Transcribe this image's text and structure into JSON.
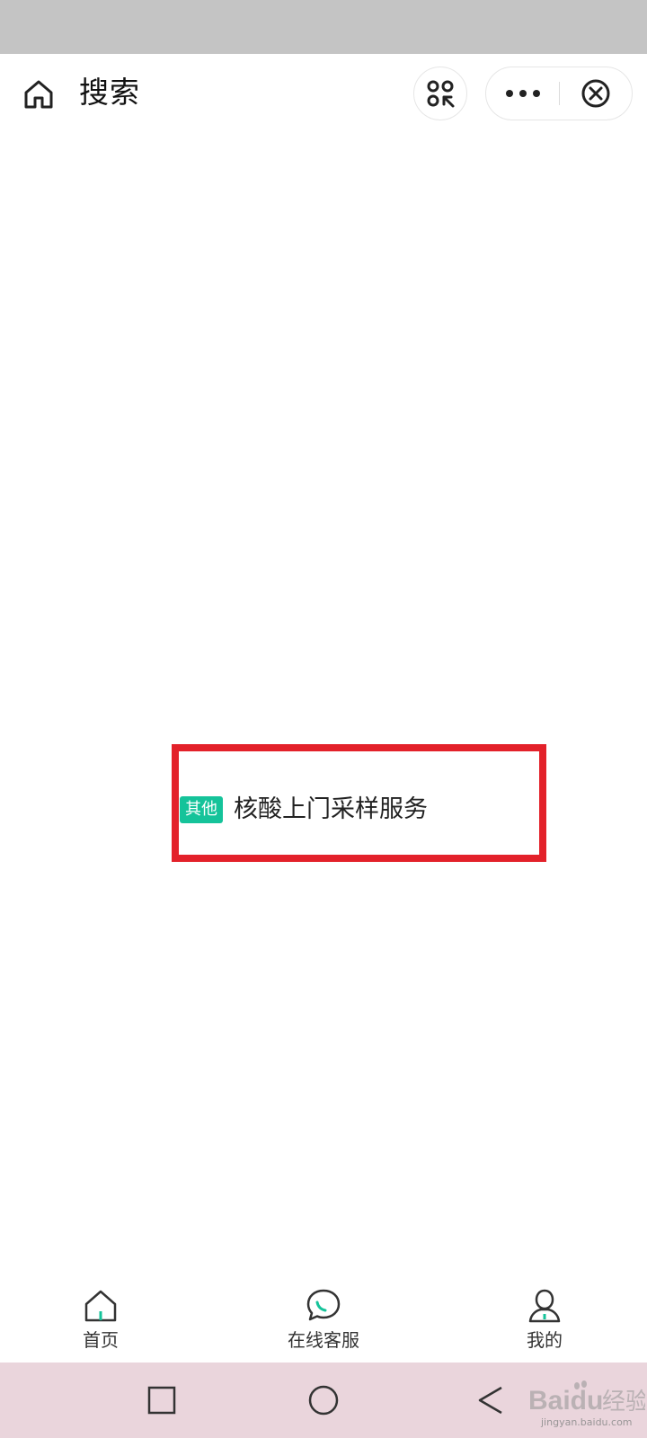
{
  "nav": {
    "title": "搜索"
  },
  "result": {
    "tag": "其他",
    "title": "核酸上门采样服务"
  },
  "tabbar": {
    "items": [
      {
        "label": "首页",
        "icon": "home-icon"
      },
      {
        "label": "在线客服",
        "icon": "chat-icon"
      },
      {
        "label": "我的",
        "icon": "person-icon"
      }
    ]
  },
  "watermark": {
    "brand": "Baidu",
    "brand_cn": "经验",
    "url": "jingyan.baidu.com"
  },
  "colors": {
    "tag": "#15c39a",
    "highlight": "#e3212a",
    "accent": "#15c39a",
    "status_bar": "#c4c4c4",
    "system_nav": "#ead5dc"
  }
}
